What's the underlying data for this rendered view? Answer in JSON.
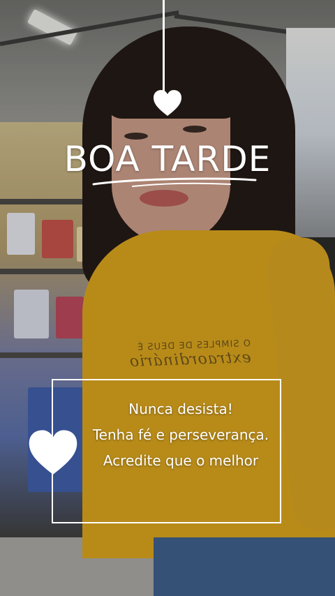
{
  "overlay": {
    "title": "BOA TARDE",
    "message_lines": [
      "Nunca desista!",
      "Tenha fé e perseverança.",
      "Acredite que o melhor"
    ],
    "accent_color": "#ffffff",
    "icons": [
      "heart-icon",
      "heart-icon"
    ]
  },
  "photo": {
    "shirt_print": [
      "O SIMPLES DE DEUS É",
      "extraordinário"
    ],
    "shirt_color": "#d7a21e"
  }
}
